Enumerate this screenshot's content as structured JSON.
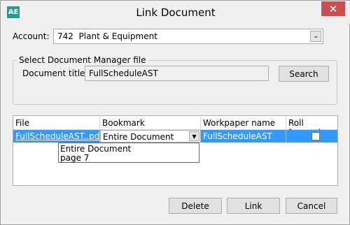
{
  "window": {
    "title": "Link Document",
    "app_icon_text": "AE",
    "close_glyph": "✕"
  },
  "account": {
    "label": "Account:",
    "value": "742  Plant & Equipment",
    "dropdown_glyph": "⌄"
  },
  "document_group": {
    "legend": "Select Document Manager file",
    "title_label": "Document title:",
    "title_value": "FullScheduleAST",
    "search_label": "Search"
  },
  "grid": {
    "headers": [
      "File",
      "Bookmark",
      "Workpaper name",
      "Roll forward"
    ],
    "rows": [
      {
        "file": "FullScheduleAST..pdf",
        "bookmark": "Entire Document",
        "workpaper_name": "FullScheduleAST",
        "roll_forward": false
      }
    ],
    "bookmark_options": [
      "Entire Document",
      "page 7"
    ],
    "bookmark_arrow_glyph": "▼"
  },
  "buttons": {
    "delete": "Delete",
    "link": "Link",
    "cancel": "Cancel"
  },
  "colors": {
    "selection": "#3399ff",
    "close_button": "#c75050",
    "app_icon": "#20a08c"
  }
}
